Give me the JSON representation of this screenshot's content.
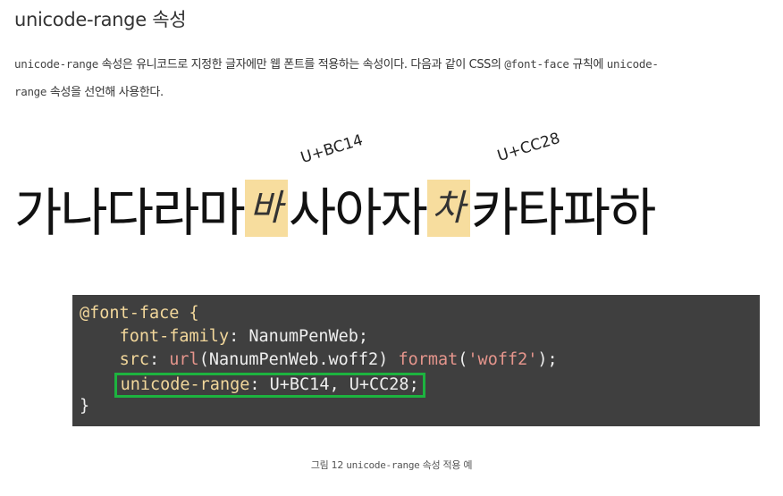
{
  "section": {
    "heading": "unicode-range 속성"
  },
  "paragraph": {
    "term1": "unicode-range",
    "text1": " 속성은 유니코드로 지정한 글자에만 웹 폰트를 적용하는 속성이다. 다음과 같이 CSS의 ",
    "term2": "@font-face",
    "text2": " 규칙에 ",
    "term3": "unicode-",
    "term4": "range",
    "text3": " 속성을 선언해 사용한다."
  },
  "figure": {
    "code_label_1": "U+BC14",
    "code_label_2": "U+CC28",
    "hangul_before": "가나다라마",
    "hangul_highlight_1": "바",
    "hangul_middle": "사아자",
    "hangul_highlight_2": "차",
    "hangul_after": "카타파하",
    "highlight_color": "#f7dd9e",
    "code": {
      "line1": "@font-face {",
      "line2_prop": "font-family",
      "line2_rest": ": NanumPenWeb;",
      "line3_prop": "src",
      "line3_colon": ": ",
      "line3_fn": "url",
      "line3_arg": "(NanumPenWeb.woff2) ",
      "line3_fn2": "format",
      "line3_paren_open": "(",
      "line3_str": "'woff2'",
      "line3_end": ");",
      "line4_prop": "unicode-range",
      "line4_rest": ": U+BC14, U+CC28;",
      "line5": "}",
      "background": "#3f3f3f",
      "highlight_border": "#1db33f"
    },
    "caption_prefix": "그림 12 ",
    "caption_term": "unicode-range",
    "caption_suffix": " 속성 적용 예"
  }
}
